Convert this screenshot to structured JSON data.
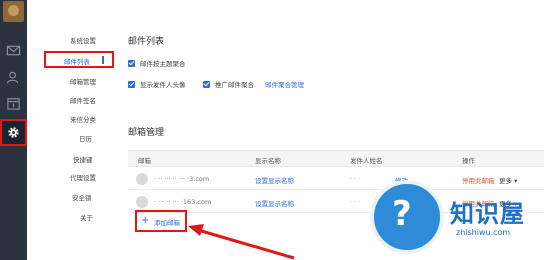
{
  "nav": {
    "items": [
      {
        "label": "系统设置"
      },
      {
        "label": "邮件列表"
      },
      {
        "label": "邮箱管理"
      },
      {
        "label": "邮件签名"
      },
      {
        "label": "来信分类"
      },
      {
        "label": "日历"
      },
      {
        "label": "快捷键"
      },
      {
        "label": "代理设置"
      },
      {
        "label": "安全锁"
      },
      {
        "label": "关于"
      }
    ]
  },
  "mail_list": {
    "title": "邮件列表",
    "options": [
      {
        "label": "邮件按主题聚合",
        "checked": true
      },
      {
        "label": "显示发件人头像",
        "checked": true
      },
      {
        "label": "推广邮件聚合",
        "checked": true
      }
    ],
    "manage_link": "邮件聚合管理"
  },
  "mailbox_mgmt": {
    "title": "邮箱管理",
    "columns": [
      "邮箱",
      "显示名称",
      "发件人姓名",
      "操作"
    ],
    "rows": [
      {
        "email": "· ·· ··· ·· ··· ·3.com",
        "display": "设置显示名称",
        "sender": "· · ·",
        "edit": "修改",
        "stop": "停用此邮箱",
        "more": "更多 ▾"
      },
      {
        "email": "· ··· ·· ··· ·163.com",
        "display": "设置显示名称",
        "sender": "· · ·",
        "edit": "",
        "stop": "停用此邮箱",
        "more": "更多 ▾"
      }
    ],
    "add_icon": "+",
    "add_label": "添加邮箱"
  },
  "watermark": {
    "title": "知识屋",
    "url": "zhishiwu.com",
    "icon": "?"
  },
  "colors": {
    "accent": "#2a6fd6",
    "highlight": "#e01818",
    "rail": "#2b3240",
    "danger": "#e05a2b"
  }
}
